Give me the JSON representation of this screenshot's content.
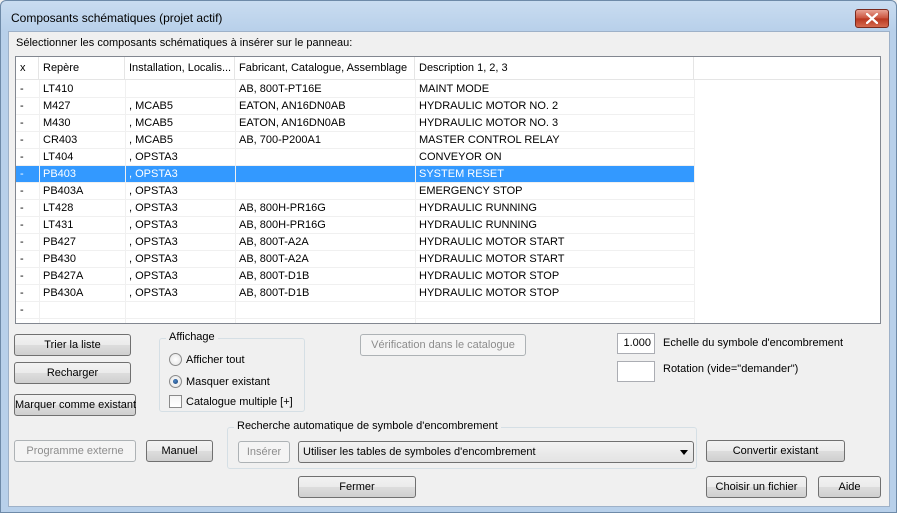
{
  "window": {
    "title": "Composants schématiques (projet actif)"
  },
  "prompt": "Sélectionner les composants schématiques à insérer sur le panneau:",
  "list": {
    "columns": [
      "x",
      "Repère",
      "Installation, Localis...",
      "Fabricant, Catalogue, Assemblage",
      "Description 1, 2, 3"
    ],
    "rows": [
      {
        "x": "-",
        "tag": "LT410",
        "loc": "",
        "mfr": "AB, 800T-PT16E",
        "desc": "MAINT MODE",
        "selected": false
      },
      {
        "x": "-",
        "tag": "M427",
        "loc": ", MCAB5",
        "mfr": "EATON, AN16DN0AB",
        "desc": "HYDRAULIC MOTOR NO. 2",
        "selected": false
      },
      {
        "x": "-",
        "tag": "M430",
        "loc": ", MCAB5",
        "mfr": "EATON, AN16DN0AB",
        "desc": "HYDRAULIC MOTOR NO. 3",
        "selected": false
      },
      {
        "x": "-",
        "tag": "CR403",
        "loc": ", MCAB5",
        "mfr": "AB, 700-P200A1",
        "desc": "MASTER CONTROL RELAY",
        "selected": false
      },
      {
        "x": "-",
        "tag": "LT404",
        "loc": ", OPSTA3",
        "mfr": "",
        "desc": "CONVEYOR ON",
        "selected": false
      },
      {
        "x": "-",
        "tag": "PB403",
        "loc": ", OPSTA3",
        "mfr": "",
        "desc": "SYSTEM RESET",
        "selected": true
      },
      {
        "x": "-",
        "tag": "PB403A",
        "loc": ", OPSTA3",
        "mfr": "",
        "desc": "EMERGENCY STOP",
        "selected": false
      },
      {
        "x": "-",
        "tag": "LT428",
        "loc": ", OPSTA3",
        "mfr": "AB, 800H-PR16G",
        "desc": "HYDRAULIC RUNNING",
        "selected": false
      },
      {
        "x": "-",
        "tag": "LT431",
        "loc": ", OPSTA3",
        "mfr": "AB, 800H-PR16G",
        "desc": "HYDRAULIC RUNNING",
        "selected": false
      },
      {
        "x": "-",
        "tag": "PB427",
        "loc": ", OPSTA3",
        "mfr": "AB, 800T-A2A",
        "desc": "HYDRAULIC MOTOR START",
        "selected": false
      },
      {
        "x": "-",
        "tag": "PB430",
        "loc": ", OPSTA3",
        "mfr": "AB, 800T-A2A",
        "desc": "HYDRAULIC MOTOR START",
        "selected": false
      },
      {
        "x": "-",
        "tag": "PB427A",
        "loc": ", OPSTA3",
        "mfr": "AB, 800T-D1B",
        "desc": "HYDRAULIC MOTOR STOP",
        "selected": false
      },
      {
        "x": "-",
        "tag": "PB430A",
        "loc": ", OPSTA3",
        "mfr": "AB, 800T-D1B",
        "desc": "HYDRAULIC MOTOR STOP",
        "selected": false
      },
      {
        "x": "-",
        "tag": "",
        "loc": "",
        "mfr": "",
        "desc": "",
        "selected": false
      }
    ]
  },
  "buttons": {
    "sort": "Trier la liste",
    "reload": "Recharger",
    "mark_existing": "Marquer comme existant",
    "catalog_check": "Vérification dans le catalogue",
    "external_program": "Programme externe",
    "manual": "Manuel",
    "insert": "Insérer",
    "convert_existing": "Convertir existant",
    "close": "Fermer",
    "choose_file": "Choisir un fichier",
    "help": "Aide"
  },
  "display_group": {
    "title": "Affichage",
    "show_all": "Afficher tout",
    "hide_existing": "Masquer existant",
    "multi_catalog": "Catalogue multiple [+]",
    "selected": "hide_existing",
    "multi_catalog_checked": false
  },
  "scale": {
    "value": "1.000",
    "label": "Echelle du symbole d'encombrement"
  },
  "rotation": {
    "value": "",
    "label": "Rotation (vide=\"demander\")"
  },
  "auto_search": {
    "title": "Recherche automatique de symbole d'encombrement",
    "combo_value": "Utiliser les tables de symboles d'encombrement"
  }
}
